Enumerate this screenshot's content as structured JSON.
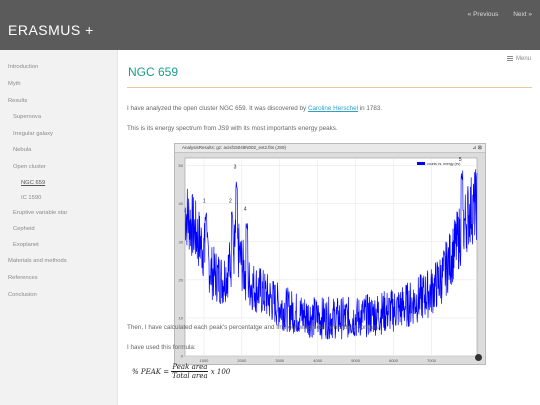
{
  "header": {
    "site_title": "ERASMUS +",
    "prev_label": "« Previous",
    "next_label": "Next »"
  },
  "sidebar": {
    "items": [
      {
        "label": "Introduction",
        "level": 0,
        "active": false
      },
      {
        "label": "Myth",
        "level": 0,
        "active": false
      },
      {
        "label": "Results",
        "level": 0,
        "active": false
      },
      {
        "label": "Supernova",
        "level": 1,
        "active": false
      },
      {
        "label": "Irregular galaxy",
        "level": 1,
        "active": false
      },
      {
        "label": "Nebula",
        "level": 1,
        "active": false
      },
      {
        "label": "Open cluster",
        "level": 1,
        "active": false
      },
      {
        "label": "NGC 659",
        "level": 2,
        "active": true
      },
      {
        "label": "IC 1590",
        "level": 2,
        "active": false
      },
      {
        "label": "Eruptive variable star",
        "level": 1,
        "active": false
      },
      {
        "label": "Cepheid",
        "level": 1,
        "active": false
      },
      {
        "label": "Exoplanet",
        "level": 1,
        "active": false
      },
      {
        "label": "Materials and methods",
        "level": 0,
        "active": false
      },
      {
        "label": "References",
        "level": 0,
        "active": false
      },
      {
        "label": "Conclusion",
        "level": 0,
        "active": false
      }
    ]
  },
  "main": {
    "menu_label": "Menu",
    "title": "NGC 659",
    "intro_prefix": "I have analyzed the open cluster NGC 659.  It was discovered by ",
    "intro_link": "Caroline Herschel",
    "intro_suffix": " in 1783.",
    "spectrum_text": "This is its energy spectrum from JS9 with its most importants energy peaks.",
    "after_text": "Then, I have calculated each peak's percentatge and find out which elements they contain.",
    "formula_text": "I have used this formula:",
    "formula": {
      "left": "% PEAK = ",
      "numerator": "Peak area",
      "denominator": "Total area",
      "right": " x 100"
    }
  },
  "plot_window": {
    "title": "AnalysisResults: gz: acisf15048N002_evt2.fits (JS9)",
    "controls": "⊿ ⊠"
  },
  "chart_data": {
    "type": "line",
    "legend": "counts vs. energy (ev)",
    "legend_position": "top-right",
    "series_color": "#0000ff",
    "xlim": [
      500,
      8200
    ],
    "ylim": [
      0,
      52
    ],
    "x_ticks": [
      "1000",
      "2000",
      "3000",
      "4000",
      "5000",
      "6000",
      "7000"
    ],
    "y_ticks": [
      "0",
      "10",
      "20",
      "30",
      "40",
      "50"
    ],
    "grid": true,
    "peak_labels": [
      {
        "label": "1",
        "x": 1050,
        "y": 40
      },
      {
        "label": "2",
        "x": 1740,
        "y": 40
      },
      {
        "label": "3",
        "x": 1860,
        "y": 49
      },
      {
        "label": "4",
        "x": 2130,
        "y": 38
      },
      {
        "label": "5",
        "x": 7800,
        "y": 51
      }
    ],
    "envelope": {
      "x": [
        500,
        800,
        1000,
        1200,
        1500,
        1700,
        1850,
        2000,
        2200,
        2500,
        3000,
        3500,
        4000,
        4500,
        5000,
        5500,
        6000,
        6500,
        7000,
        7300,
        7600,
        7800,
        8000,
        8200
      ],
      "y": [
        38,
        32,
        28,
        22,
        20,
        24,
        30,
        24,
        19,
        17,
        13,
        11,
        10,
        10,
        10,
        11,
        12,
        14,
        17,
        21,
        28,
        33,
        38,
        40
      ]
    }
  }
}
